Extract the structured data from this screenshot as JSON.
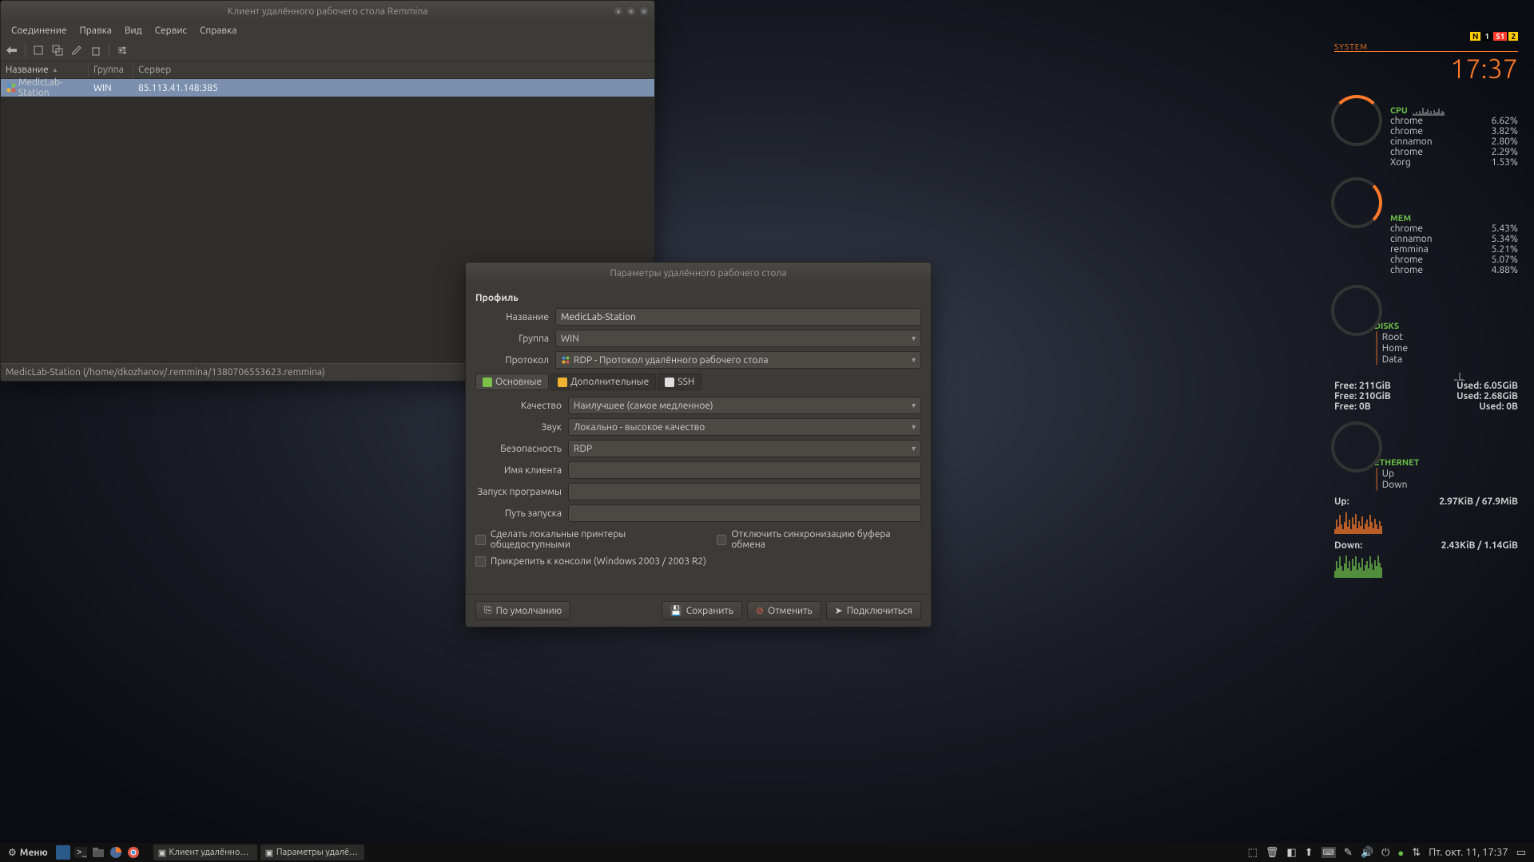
{
  "main_window": {
    "title": "Клиент удалённого рабочего стола Remmina",
    "menubar": [
      "Соединение",
      "Правка",
      "Вид",
      "Сервис",
      "Справка"
    ],
    "columns": {
      "name": "Название",
      "group": "Группа",
      "server": "Сервер"
    },
    "row": {
      "name": "MedicLab-Station",
      "group": "WIN",
      "server": "85.113.41.148:385"
    },
    "status": "MedicLab-Station (/home/dkozhanov/.remmina/1380706553623.remmina)"
  },
  "dialog": {
    "title": "Параметры удалённого рабочего стола",
    "section_profile": "Профиль",
    "labels": {
      "name": "Название",
      "group": "Группа",
      "protocol": "Протокол",
      "quality": "Качество",
      "sound": "Звук",
      "security": "Безопасность",
      "clientname": "Имя клиента",
      "startprog": "Запуск программы",
      "startpath": "Путь запуска"
    },
    "values": {
      "name": "MedicLab-Station",
      "group": "WIN",
      "protocol": "RDP - Протокол удалённого рабочего стола",
      "quality": "Наилучшее (самое медленное)",
      "sound": "Локально - высокое качество",
      "security": "RDP",
      "clientname": "",
      "startprog": "",
      "startpath": ""
    },
    "tabs": {
      "basic": "Основные",
      "advanced": "Дополнительные",
      "ssh": "SSH"
    },
    "checks": {
      "printers": "Сделать локальные принтеры общедоступными",
      "clipboard": "Отключить синхронизацию буфера обмена",
      "console": "Прикрепить к консоли (Windows 2003 / 2003 R2)"
    },
    "buttons": {
      "default": "По умолчанию",
      "save": "Сохранить",
      "cancel": "Отменить",
      "connect": "Подключиться"
    }
  },
  "conky": {
    "system": "SYSTEM",
    "time": "17:37",
    "badges": [
      {
        "t": "N",
        "bg": "#ffcc00"
      },
      {
        "t": "1",
        "bg": "#000"
      },
      {
        "t": "51",
        "bg": "#ff3a2a"
      },
      {
        "t": "2",
        "bg": "#ffcc00"
      }
    ],
    "cpu": {
      "label": "CPU",
      "procs": [
        [
          "chrome",
          "6.62%"
        ],
        [
          "chrome",
          "3.82%"
        ],
        [
          "cinnamon",
          "2.80%"
        ],
        [
          "chrome",
          "2.29%"
        ],
        [
          "Xorg",
          "1.53%"
        ]
      ]
    },
    "mem": {
      "label": "MEM",
      "procs": [
        [
          "chrome",
          "5.43%"
        ],
        [
          "cinnamon",
          "5.34%"
        ],
        [
          "remmina",
          "5.21%"
        ],
        [
          "chrome",
          "5.07%"
        ],
        [
          "chrome",
          "4.88%"
        ]
      ]
    },
    "disks": {
      "label": "DISKS",
      "parts": [
        "Root",
        "Home",
        "Data"
      ],
      "rows": [
        [
          "Free: 211GiB",
          "Used: 6.05GiB"
        ],
        [
          "Free: 210GiB",
          "Used: 2.68GiB"
        ],
        [
          "Free: 0B",
          "Used: 0B"
        ]
      ]
    },
    "eth": {
      "label": "ETHERNET",
      "up": "Up",
      "down": "Down",
      "upval": "Up:",
      "uptot": "2.97KiB / 67.9MiB",
      "downval": "Down:",
      "downtot": "2.43KiB / 1.14GiB"
    }
  },
  "panel": {
    "menu": "Меню",
    "tasks": [
      "Клиент удалённого ...",
      "Параметры удалён..."
    ],
    "clock": "Пт. окт. 11, 17:37"
  }
}
